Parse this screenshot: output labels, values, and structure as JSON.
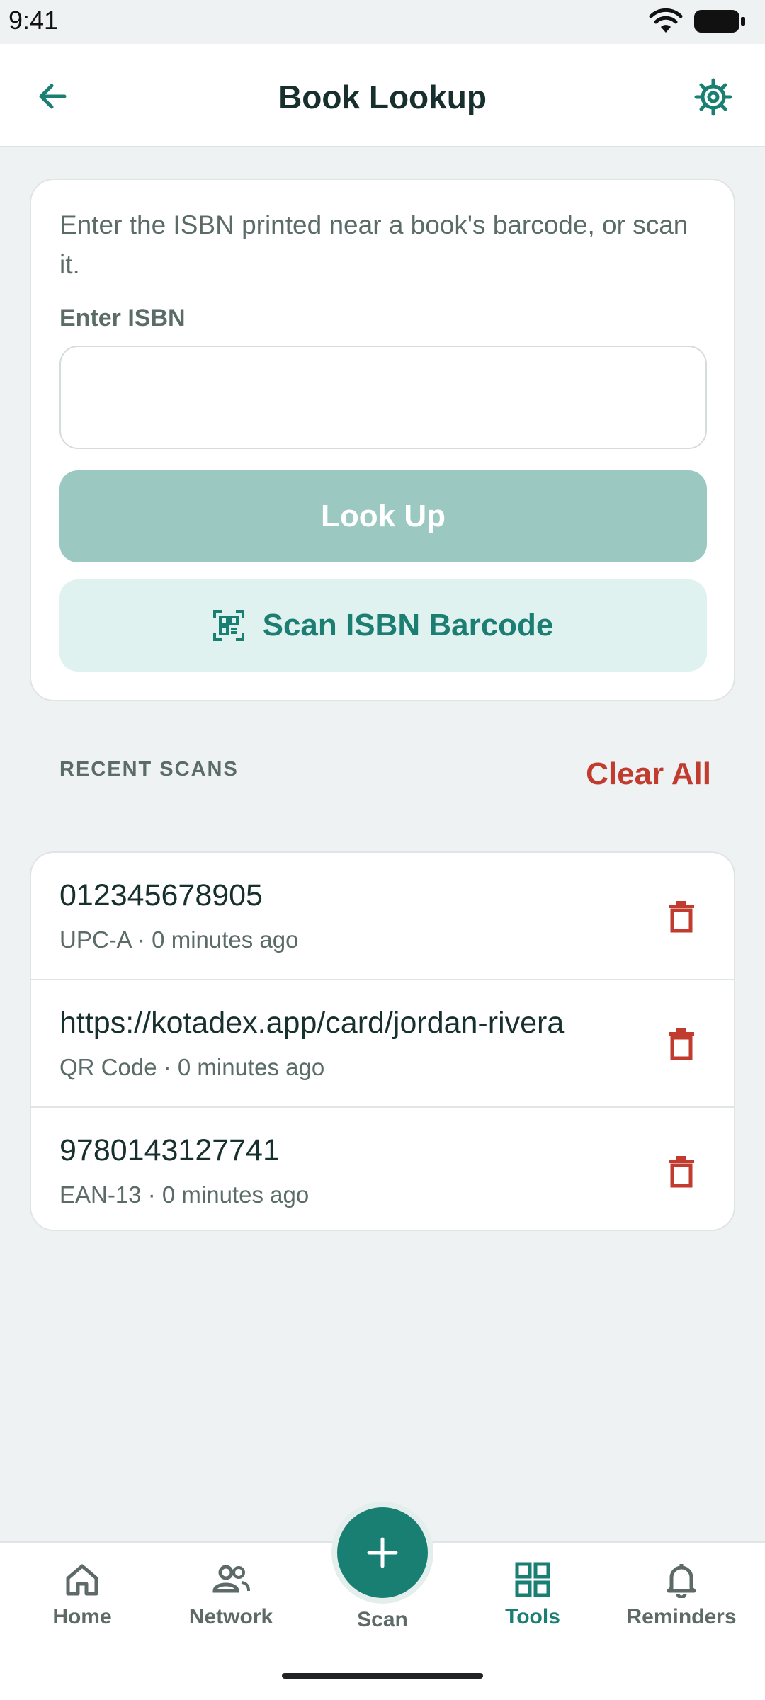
{
  "status_bar": {
    "time": "9:41"
  },
  "app_bar": {
    "title": "Book Lookup"
  },
  "lookup": {
    "helper_text": "Enter the ISBN printed near a book's barcode, or scan it.",
    "field_label": "Enter ISBN",
    "isbn_value": "",
    "lookup_label": "Look Up",
    "scan_label": "Scan ISBN Barcode"
  },
  "recent": {
    "section_label": "RECENT SCANS",
    "clear_label": "Clear All",
    "items": [
      {
        "value": "012345678905",
        "meta": "UPC-A · 0 minutes ago"
      },
      {
        "value": "https://kotadex.app/card/jordan-rivera",
        "meta": "QR Code · 0 minutes ago"
      },
      {
        "value": "9780143127741",
        "meta": "EAN-13 · 0 minutes ago"
      }
    ]
  },
  "nav": {
    "home": "Home",
    "network": "Network",
    "scan": "Scan",
    "tools": "Tools",
    "reminders": "Reminders",
    "active": "tools"
  },
  "colors": {
    "accent": "#1a7f73",
    "danger": "#c23b2f",
    "disabled_button": "#9bc9c2",
    "scan_button_bg": "#e0f2ef",
    "background": "#eef2f2"
  }
}
